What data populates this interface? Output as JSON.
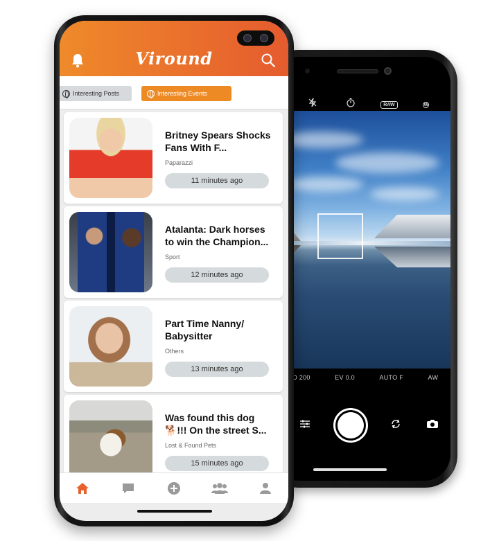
{
  "camera": {
    "modes": [
      "O 200",
      "EV 0.0",
      "AUTO F",
      "AW"
    ],
    "raw_label": "RAW",
    "wb_label": "W"
  },
  "app": {
    "logo": "Viround",
    "filters": {
      "posts_label": "Interesting Posts",
      "events_label": "Interesting Events"
    },
    "feed": [
      {
        "title": "Britney Spears Shocks Fans With F...",
        "category": "Paparazzi",
        "time": "11 minutes ago"
      },
      {
        "title": "Atalanta: Dark horses to win the Champion...",
        "category": "Sport",
        "time": "12 minutes ago"
      },
      {
        "title": "Part Time Nanny/ Babysitter",
        "category": "Others",
        "time": "13 minutes ago"
      },
      {
        "title": "Was found this dog 🐕!!! On the street S...",
        "category": "Lost & Found Pets",
        "time": "15 minutes ago"
      }
    ]
  },
  "colors": {
    "header_start": "#ef8a2a",
    "header_end": "#e55b2e",
    "accent": "#ee8a24",
    "nav_active": "#e8612c",
    "nav_inactive": "#9a9a9a"
  }
}
